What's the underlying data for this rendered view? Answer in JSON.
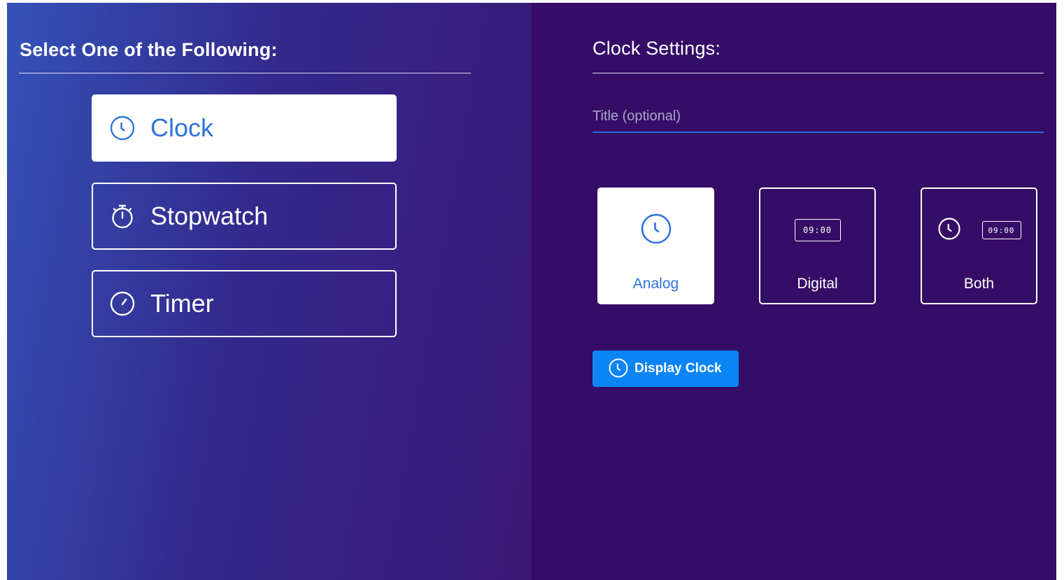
{
  "left_panel": {
    "heading": "Select One of the Following:",
    "options": [
      {
        "label": "Clock",
        "icon": "clock-icon",
        "selected": true
      },
      {
        "label": "Stopwatch",
        "icon": "stopwatch-icon",
        "selected": false
      },
      {
        "label": "Timer",
        "icon": "timer-icon",
        "selected": false
      }
    ]
  },
  "right_panel": {
    "heading": "Clock Settings:",
    "title_field": {
      "placeholder": "Title (optional)",
      "value": ""
    },
    "styles": [
      {
        "label": "Analog",
        "icon": "analog-clock-icon",
        "selected": true
      },
      {
        "label": "Digital",
        "icon": "digital-clock-icon",
        "display_text": "09:00",
        "selected": false
      },
      {
        "label": "Both",
        "icon": "analog-and-digital-icon",
        "display_text": "09:00",
        "selected": false
      }
    ],
    "display_button": {
      "label": "Display Clock",
      "icon": "clock-icon"
    }
  },
  "colors": {
    "selected_text": "#2e73de",
    "button_bg": "#0b84f5",
    "right_panel_bg": "#350d66",
    "input_underline": "#2f66e6"
  }
}
